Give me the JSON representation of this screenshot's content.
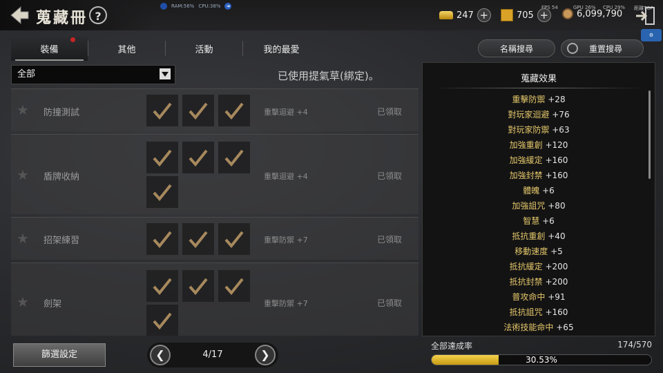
{
  "header": {
    "title": "蒐藏冊",
    "help_label": "?",
    "ram": "RAM:56%",
    "cpu_sys": "CPU:38%",
    "gold": "247",
    "scroll": "705",
    "coins": "6,099,790",
    "fps": "FPS  54",
    "gpu": "GPU 26%",
    "cpu": "CPU 29%",
    "extra": "距離TOP"
  },
  "tabs": [
    {
      "label": "裝備"
    },
    {
      "label": "其他"
    },
    {
      "label": "活動"
    },
    {
      "label": "我的最愛"
    }
  ],
  "buttons": {
    "name_search": "名稱搜尋",
    "reset_search": "重置搜尋",
    "filter": "篩選設定"
  },
  "dropdown": {
    "selected": "全部"
  },
  "note": "已使用提氣草(綁定)。",
  "rows": [
    {
      "name": "防撞測試",
      "checks": 3,
      "effect": "重擊迴避 +4",
      "status": "已領取"
    },
    {
      "name": "盾牌收納",
      "checks": 4,
      "effect": "重擊迴避 +4",
      "status": "已領取"
    },
    {
      "name": "招架練習",
      "checks": 3,
      "effect": "重擊防禦 +7",
      "status": "已領取"
    },
    {
      "name": "劍架",
      "checks": 4,
      "effect": "重擊防禦 +7",
      "status": "已領取"
    }
  ],
  "panel": {
    "title": "蒐藏效果",
    "effects": [
      {
        "stat": "重擊防禦",
        "value": "+28"
      },
      {
        "stat": "對玩家迴避",
        "value": "+76"
      },
      {
        "stat": "對玩家防禦",
        "value": "+63"
      },
      {
        "stat": "加強重創",
        "value": "+120"
      },
      {
        "stat": "加強緩定",
        "value": "+160"
      },
      {
        "stat": "加強封禁",
        "value": "+160"
      },
      {
        "stat": "體魄",
        "value": "+6"
      },
      {
        "stat": "加強詛咒",
        "value": "+80"
      },
      {
        "stat": "智慧",
        "value": "+6"
      },
      {
        "stat": "抵抗重創",
        "value": "+40"
      },
      {
        "stat": "移動速度",
        "value": "+5"
      },
      {
        "stat": "抵抗緩定",
        "value": "+200"
      },
      {
        "stat": "抵抗封禁",
        "value": "+200"
      },
      {
        "stat": "普攻命中",
        "value": "+91"
      },
      {
        "stat": "抵抗詛咒",
        "value": "+160"
      },
      {
        "stat": "法術技能命中",
        "value": "+65"
      }
    ]
  },
  "pager": {
    "text": "4/17",
    "prev": "❮",
    "next": "❯"
  },
  "achievement": {
    "label": "全部達成率",
    "count": "174/570",
    "percent_text": "30.53%",
    "fraction": 0.3053
  },
  "colors": {
    "accent_gold": "#e4c76a",
    "progress": "#f4d24c"
  }
}
